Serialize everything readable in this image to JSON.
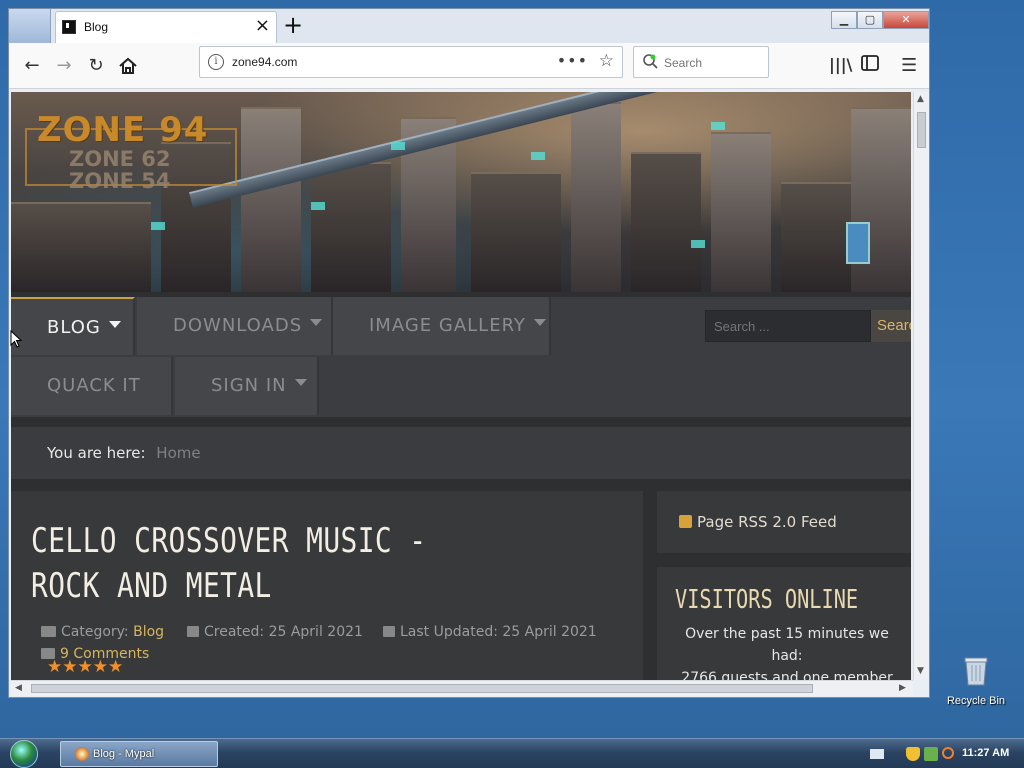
{
  "browser": {
    "tab_title": "Blog",
    "url": "zone94.com",
    "search_placeholder": "Search",
    "window_controls": {
      "minimize": "▁",
      "maximize": "▢",
      "close": "✕"
    }
  },
  "site": {
    "logo": {
      "line1": "ZONE 94",
      "line2": "ZONE 62",
      "line3": "ZONE 54"
    },
    "menu": {
      "row1": [
        {
          "label": "BLOG",
          "dropdown": true,
          "active": true
        },
        {
          "label": "DOWNLOADS",
          "dropdown": true
        },
        {
          "label": "IMAGE GALLERY",
          "dropdown": true
        }
      ],
      "row2": [
        {
          "label": "QUACK IT",
          "dropdown": false
        },
        {
          "label": "SIGN IN",
          "dropdown": true
        }
      ]
    },
    "search": {
      "placeholder": "Search ...",
      "button": "Search"
    },
    "breadcrumb": {
      "lead": "You are here:",
      "current": "Home"
    },
    "article": {
      "title": "CELLO CROSSOVER MUSIC - ROCK AND METAL",
      "category_label": "Category:",
      "category": "Blog",
      "created": "Created: 25 April 2021",
      "updated": "Last Updated: 25 April 2021",
      "comments": "9 Comments",
      "rating_stars": 5
    },
    "sidebar": {
      "rss": "Page RSS 2.0 Feed",
      "visitors_title": "VISITORS ONLINE",
      "visitors_text_line1": "Over the past 15 minutes we",
      "visitors_text_line2": "had:",
      "visitors_text_line3": "2766 guests and one member"
    }
  },
  "desktop": {
    "recycle_bin": "Recycle Bin"
  },
  "taskbar": {
    "task": "Blog - Mypal",
    "clock": "11:27 AM"
  },
  "colors": {
    "accent": "#d7b55b",
    "page_bg": "#2d2f31",
    "star": "#f0902a"
  }
}
